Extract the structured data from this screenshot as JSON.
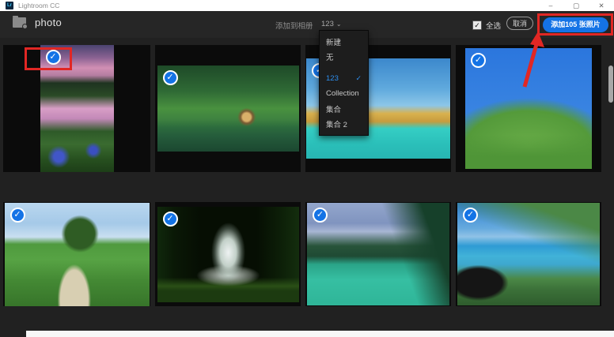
{
  "titlebar": {
    "logo_text": "Lr",
    "app_title": "Lightroom CC",
    "minimize_icon": "–",
    "maximize_icon": "▢",
    "close_icon": "✕"
  },
  "header": {
    "library_name": "photo",
    "add_to_album_label": "添加到相册",
    "album_selector_value": "123",
    "caret_icon": "⌄",
    "select_all_label": "全选",
    "select_all_checked": true,
    "checkbox_check_icon": "✓",
    "cancel_button_label": "取消",
    "add_photos_button_label": "添加105 张照片"
  },
  "album_dropdown": {
    "items": [
      {
        "label": "新建",
        "selected": false
      },
      {
        "label": "无",
        "selected": false
      },
      {
        "label": "123",
        "selected": true,
        "check_icon": "✓"
      },
      {
        "label": "Collection",
        "selected": false
      },
      {
        "label": "集合",
        "selected": false
      },
      {
        "label": "集合 2",
        "selected": false
      }
    ]
  },
  "grid": {
    "checkmark_icon": "✓",
    "photos": [
      {
        "name": "sunset-stream-portrait",
        "selected": true
      },
      {
        "name": "forest-cottage-lake",
        "selected": true
      },
      {
        "name": "desert-dune-lagoon",
        "selected": true
      },
      {
        "name": "green-tree-blue-sky",
        "selected": true
      },
      {
        "name": "lone-tree-meadow-path",
        "selected": true
      },
      {
        "name": "night-garden-fountain",
        "selected": true
      },
      {
        "name": "mountain-turquoise-lake",
        "selected": true
      },
      {
        "name": "coastal-cliff-beach",
        "selected": true
      }
    ]
  },
  "colors": {
    "accent_blue": "#1473e6",
    "selection_badge_blue": "#1473e6",
    "dropdown_selected_text": "#2d8ff0",
    "annotation_red": "#e12724",
    "titlebar_bg": "#ffffff",
    "header_bg": "#262626",
    "content_bg": "#212121"
  }
}
